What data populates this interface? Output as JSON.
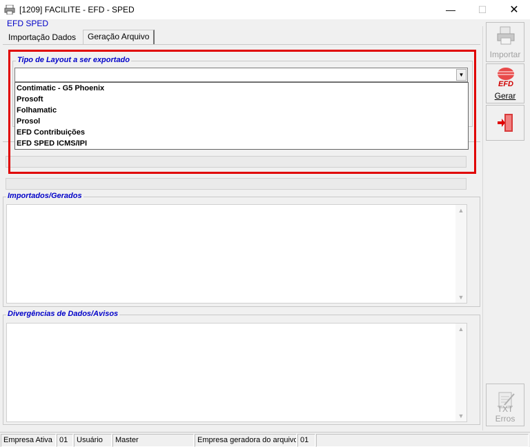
{
  "window": {
    "title": "[1209] FACILITE - EFD - SPED",
    "minimize": "—",
    "maximize": "☐",
    "close": "✕"
  },
  "header": {
    "label": "EFD SPED"
  },
  "tabs": [
    {
      "label": "Importação Dados",
      "active": false
    },
    {
      "label": "Geração Arquivo",
      "active": true
    }
  ],
  "layout_group": {
    "label": "Tipo de Layout a ser exportado",
    "combo_value": "",
    "options": [
      "Contimatic - G5 Phoenix",
      "Prosoft",
      "Folhamatic",
      "Prosol",
      "EFD Contribuições",
      "EFD SPED ICMS/IPI"
    ]
  },
  "imported_group": {
    "label": "Importados/Gerados",
    "content": ""
  },
  "warnings_group": {
    "label": "Divergências de Dados/Avisos",
    "content": ""
  },
  "toolbar": {
    "import_label": "Importar",
    "generate_label": "Gerar",
    "txt_errors_label": "TXT Erros",
    "efd_icon_text": "EFD"
  },
  "statusbar": {
    "company_label": "Empresa Ativa",
    "company_value": "01",
    "user_label": "Usuário",
    "user_value": "Master",
    "generator_label": "Empresa geradora do arquivo",
    "generator_value": "01"
  },
  "colors": {
    "accent_blue": "#0000c8",
    "highlight_red": "#e00000",
    "window_bg": "#f0f0f0"
  }
}
